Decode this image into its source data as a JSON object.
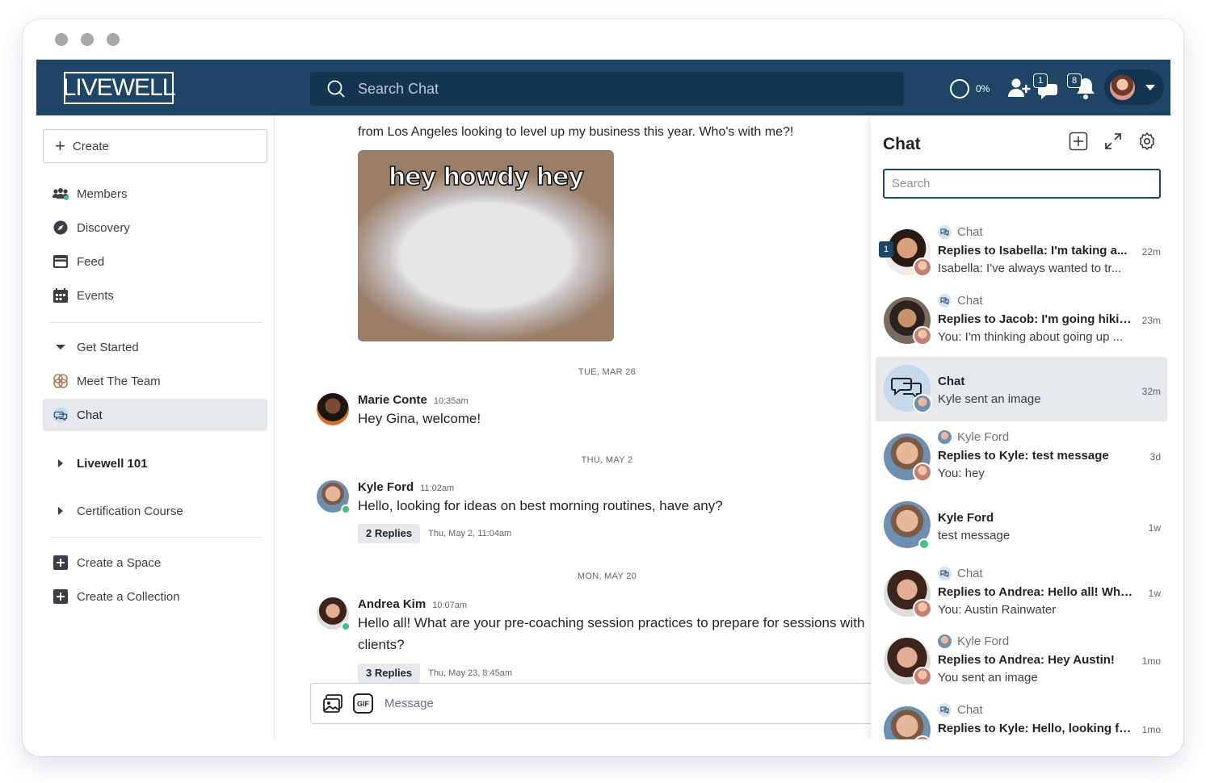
{
  "topbar": {
    "logo_text": "LIVEWELL",
    "search_placeholder": "Search Chat",
    "progress_label": "0%",
    "friend_requests_badge": "1",
    "notifications_badge": "8",
    "colors": {
      "bar": "#1e4466",
      "search": "#153450"
    }
  },
  "sidebar": {
    "create_label": "Create",
    "items": [
      {
        "label": "Members",
        "icon": "members-icon"
      },
      {
        "label": "Discovery",
        "icon": "compass-icon"
      },
      {
        "label": "Feed",
        "icon": "feed-icon"
      },
      {
        "label": "Events",
        "icon": "calendar-icon"
      }
    ],
    "spaces": [
      {
        "label": "Get Started",
        "icon": "caret-down-icon"
      },
      {
        "label": "Meet The Team",
        "icon": "team-icon"
      },
      {
        "label": "Chat",
        "icon": "chat-bubbles-icon",
        "active": true
      }
    ],
    "collections": [
      {
        "label": "Livewell 101",
        "icon": "caret-right-icon"
      },
      {
        "label": "Certification Course",
        "icon": "caret-right-icon"
      }
    ],
    "actions": [
      {
        "label": "Create a Space",
        "icon": "plus-square-icon"
      },
      {
        "label": "Create a Collection",
        "icon": "plus-square-icon"
      }
    ]
  },
  "main": {
    "cut_text": "from Los Angeles looking to level up my business this year. Who's with me?!",
    "gif_caption": "hey howdy hey",
    "messages": [
      {
        "date": "TUE, MAR 26",
        "name": "Marie Conte",
        "time": "10:35am",
        "text": "Hey Gina, welcome!"
      },
      {
        "date": "THU, MAY 2",
        "name": "Kyle Ford",
        "time": "11:02am",
        "text": "Hello, looking for ideas on best morning routines, have any?",
        "replies": "2 Replies",
        "replies_time": "Thu, May 2, 11:04am"
      },
      {
        "date": "MON, MAY 20",
        "name": "Andrea Kim",
        "time": "10:07am",
        "text": "Hello all! What are your pre-coaching session practices to prepare for sessions with",
        "text2": "clients?",
        "replies": "3 Replies",
        "replies_time": "Thu, May 23, 8:45am"
      }
    ],
    "composer_placeholder": "Message"
  },
  "panel": {
    "title": "Chat",
    "search_placeholder": "Search",
    "conversations": [
      {
        "source": "Chat",
        "title": "Replies to Isabella: I'm taking a...",
        "preview": "Isabella: I've always wanted to tr...",
        "age": "22m",
        "unread": "1"
      },
      {
        "source": "Chat",
        "title": "Replies to Jacob: I'm going hiking...",
        "preview": "You: I'm thinking about going up ...",
        "age": "23m"
      },
      {
        "title": "Chat",
        "preview": "Kyle sent an image",
        "age": "32m",
        "active": true
      },
      {
        "source": "Kyle Ford",
        "title": "Replies to Kyle: test message",
        "preview": "You: hey",
        "age": "3d"
      },
      {
        "title": "Kyle Ford",
        "preview": "test message",
        "age": "1w"
      },
      {
        "source": "Chat",
        "title": "Replies to Andrea: Hello all! What...",
        "preview": "You: Austin Rainwater",
        "age": "1w"
      },
      {
        "source": "Kyle Ford",
        "title": "Replies to Andrea: Hey Austin!",
        "preview": "You sent an image",
        "age": "1mo"
      },
      {
        "source": "Chat",
        "title": "Replies to Kyle: Hello, looking for ...",
        "preview": "",
        "age": "1mo"
      }
    ]
  }
}
